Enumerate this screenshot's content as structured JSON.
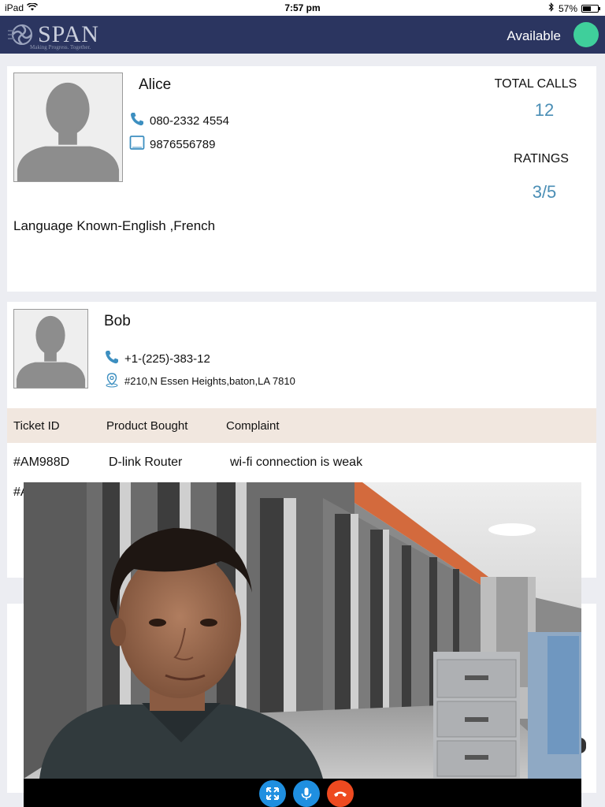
{
  "status_bar": {
    "device": "iPad",
    "time": "7:57 pm",
    "battery": "57%",
    "battery_level": 0.57
  },
  "header": {
    "logo_text": "SPAN",
    "logo_tagline": "Making Progress. Together.",
    "availability": "Available",
    "availability_color": "#3fcf9b"
  },
  "agent": {
    "name": "Alice",
    "phone": "080-2332 4554",
    "mobile": "9876556789",
    "languages": "Language Known-English ,French",
    "total_calls_label": "TOTAL CALLS",
    "total_calls": "12",
    "ratings_label": "RATINGS",
    "ratings": "3/5"
  },
  "customer": {
    "name": "Bob",
    "phone": "+1-(225)-383-12",
    "address": "#210,N Essen Heights,baton,LA 7810"
  },
  "tickets": {
    "columns": [
      "Ticket ID",
      "Product Bought",
      "Complaint"
    ],
    "rows": [
      [
        "#AM988D",
        "D-link Router",
        "wi-fi  connection is weak"
      ]
    ],
    "partial_row_id": "#A"
  },
  "video_call": {
    "controls": [
      {
        "name": "expand",
        "icon": "expand-icon",
        "color": "#1f8fe0"
      },
      {
        "name": "mute",
        "icon": "microphone-icon",
        "color": "#1f8fe0"
      },
      {
        "name": "end-call",
        "icon": "phone-hangup-icon",
        "color": "#ee4a20"
      }
    ]
  },
  "colors": {
    "header_bg": "#2b3560",
    "accent_value": "#4a8eb5",
    "table_header_bg": "#f1e7df"
  }
}
